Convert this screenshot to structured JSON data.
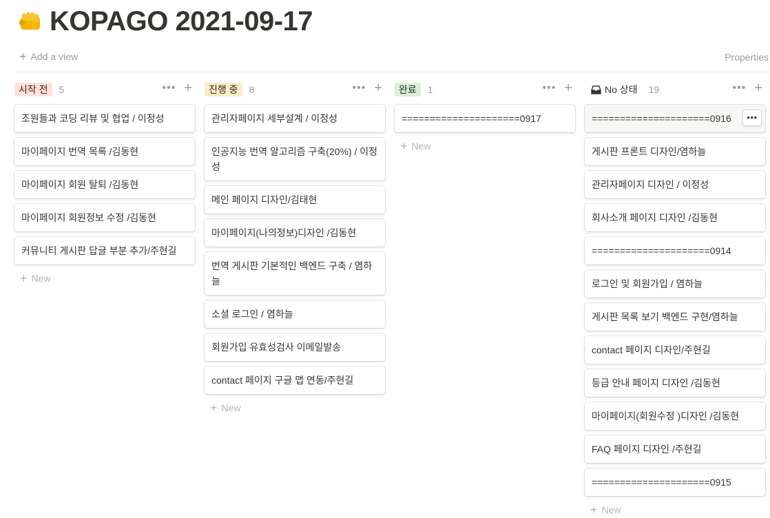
{
  "page": {
    "title": "KOPAGO 2021-09-17",
    "icon": "fist-icon"
  },
  "toolbar": {
    "add_view": "Add a view",
    "properties": "Properties"
  },
  "columns": [
    {
      "label": "시작 전",
      "count": "5",
      "pill_bg": "#ffe2dd",
      "pill_color": "#5d1715",
      "new_label": "New",
      "cards": [
        "조원들과 코딩 리뷰 및 협업 / 이정성",
        "마이페이지 번역 목록 /김동현",
        "마이페이지 회원 탈퇴 /김동현",
        "마이페이지 회원정보 수정 /김동현",
        "커뮤니티 게시판 답글 부분 추가/주현길"
      ]
    },
    {
      "label": "진행 중",
      "count": "8",
      "pill_bg": "#fdecc8",
      "pill_color": "#402c1b",
      "new_label": "New",
      "cards": [
        "관리자페이지 세부설계 / 이정성",
        "인공지능 번역 알고리즘 구축(20%) / 이정성",
        "메인 페이지 디자인/김태현",
        "마이페이지(나의정보)디자인 /김동현",
        "번역 게시판 기본적인 백엔드 구축 / 염하늘",
        "소셜 로그인 / 염하늘",
        "회원가입 유효성검사 이메일발송",
        "contact 페이지 구글 맵 연동/주현길"
      ]
    },
    {
      "label": "완료",
      "count": "1",
      "pill_bg": "#dbeddb",
      "pill_color": "#1c3829",
      "new_label": "New",
      "cards": [
        "=====================0917"
      ]
    },
    {
      "label": "No 상태",
      "count": "19",
      "pill_bg": "transparent",
      "pill_color": "#37352f",
      "new_label": "New",
      "cards": [
        "=====================0916",
        "게시판 프론트 디자인/염하늘",
        "관리자페이지 디자인 / 이정성",
        "회사소개 페이지 디자인 /김동현",
        "=====================0914",
        "로그인 및 회원가입 / 염하늘",
        "게시판 목록 보기 백엔드 구현/염하늘",
        "contact 페이지 디자인/주현길",
        "등급 안내 페이지 디자인 /김동현",
        "마이페이지(회원수정 )디자인 /김동현",
        "FAQ 페이지 디자인 /주현길",
        "=====================0915"
      ]
    }
  ]
}
